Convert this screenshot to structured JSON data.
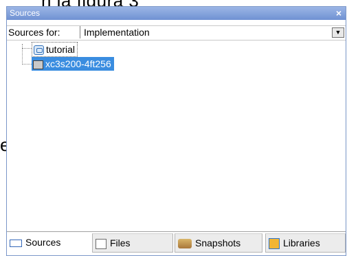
{
  "background": {
    "top_text": "n la figura 3",
    "left_text": "e"
  },
  "panel": {
    "title": "Sources",
    "close_glyph": "×",
    "sources_for": {
      "label": "Sources for:",
      "value": "Implementation",
      "dropdown_glyph": "▼"
    },
    "tree": [
      {
        "label": "tutorial",
        "icon": "project-icon",
        "selected": false,
        "focused": true
      },
      {
        "label": "xc3s200-4ft256",
        "icon": "chip-icon",
        "selected": true,
        "focused": false
      }
    ],
    "tabs": [
      {
        "label": "Sources",
        "icon": "sources-tab-icon",
        "active": true
      },
      {
        "label": "Files",
        "icon": "files-tab-icon",
        "active": false
      },
      {
        "label": "Snapshots",
        "icon": "snapshots-tab-icon",
        "active": false
      },
      {
        "label": "Libraries",
        "icon": "libraries-tab-icon",
        "active": false
      }
    ]
  },
  "colors": {
    "title_bar": "#7f9fdb",
    "selection": "#3a8de0"
  }
}
